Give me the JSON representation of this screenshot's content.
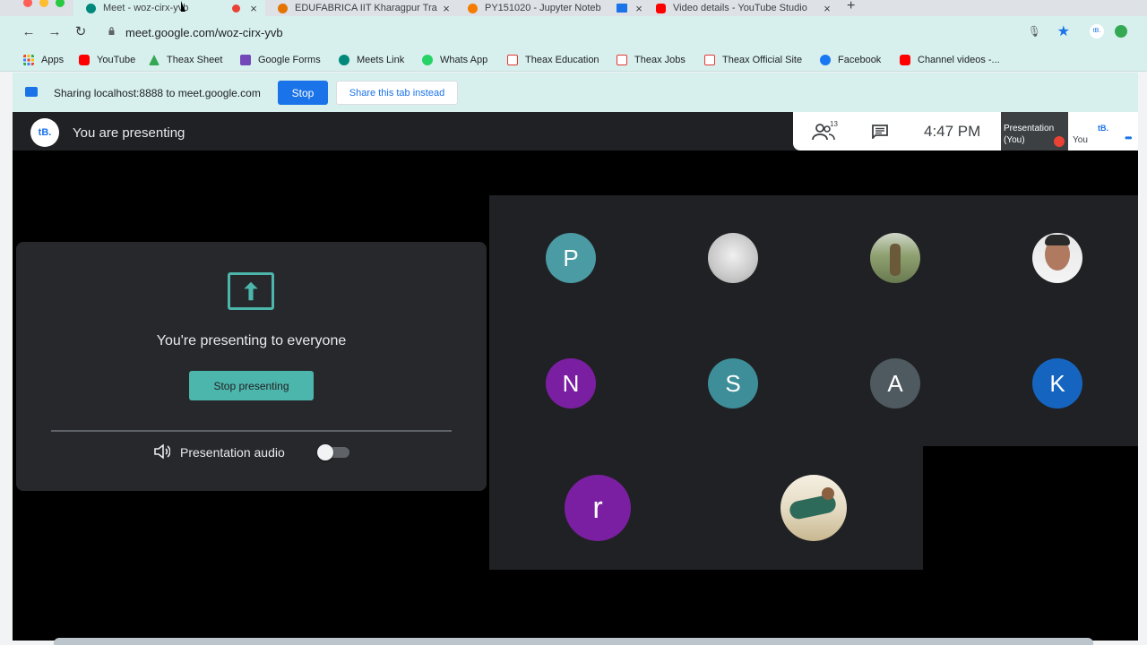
{
  "browser": {
    "tabs": [
      {
        "title": "Meet - woz-cirx-yvb",
        "active": true,
        "favicon_color": "#00897b"
      },
      {
        "title": "EDUFABRICA IIT Kharagpur Tra",
        "active": false,
        "favicon_color": "#e37400"
      },
      {
        "title": "PY151020 - Jupyter Noteb",
        "active": false,
        "favicon_color": "#f57c00"
      },
      {
        "title": "Video details - YouTube Studio",
        "active": false,
        "favicon_color": "#ff0000"
      }
    ],
    "new_tab_symbol": "+",
    "url": "meet.google.com/woz-cirx-yvb",
    "bookmarks": [
      {
        "label": "Apps",
        "color": "#ea4335"
      },
      {
        "label": "YouTube",
        "color": "#ff0000"
      },
      {
        "label": "Theax Sheet",
        "color": "#34a853"
      },
      {
        "label": "Google Forms",
        "color": "#7248b9"
      },
      {
        "label": "Meets Link",
        "color": "#00897b"
      },
      {
        "label": "Whats App",
        "color": "#25d366"
      },
      {
        "label": "Theax Education",
        "color": "#e53935"
      },
      {
        "label": "Theax Jobs",
        "color": "#e53935"
      },
      {
        "label": "Theax Official Site",
        "color": "#e53935"
      },
      {
        "label": "Facebook",
        "color": "#1877f2"
      },
      {
        "label": "Channel videos -...",
        "color": "#ff0000"
      }
    ]
  },
  "share_bar": {
    "text": "Sharing localhost:8888 to meet.google.com",
    "stop_label": "Stop",
    "share_tab_label": "Share this tab instead"
  },
  "meet": {
    "logo_text": "tB.",
    "presenting_label": "You are presenting",
    "people_count": "13",
    "time": "4:47 PM",
    "presentation_tile": "Presentation (You)",
    "you_label": "You",
    "card": {
      "title": "You're presenting to everyone",
      "stop_button": "Stop presenting",
      "audio_label": "Presentation audio",
      "audio_on": false
    },
    "participants": [
      {
        "initial": "P",
        "color": "#4a9ba3"
      },
      {
        "initial": "",
        "color": "#d0d0d0"
      },
      {
        "initial": "",
        "color": "#7a9060"
      },
      {
        "initial": "",
        "color": "#a08070"
      },
      {
        "initial": "N",
        "color": "#7b1fa2"
      },
      {
        "initial": "S",
        "color": "#3d8e98"
      },
      {
        "initial": "A",
        "color": "#4e5a60"
      },
      {
        "initial": "K",
        "color": "#1565c0"
      },
      {
        "initial": "r",
        "color": "#7b1fa2"
      },
      {
        "initial": "",
        "color": "#a89878"
      }
    ]
  },
  "colors": {
    "accent_blue": "#1a73e8",
    "teal": "#4db6ac",
    "meet_bg": "#202124",
    "chrome_bar": "#d7f0ee"
  }
}
